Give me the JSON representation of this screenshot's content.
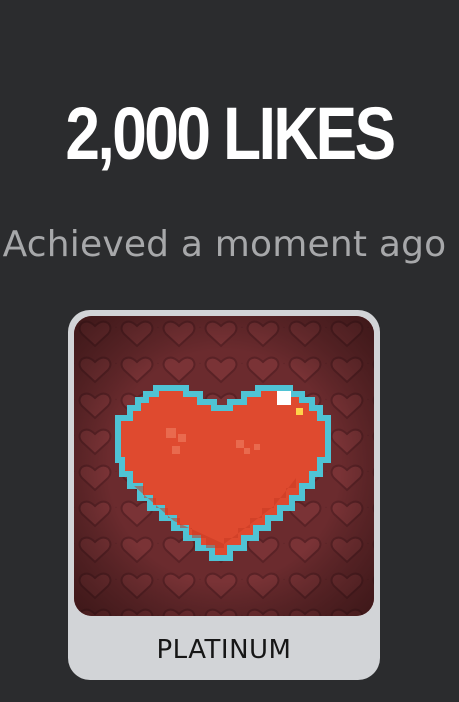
{
  "achievement": {
    "title": "2,000 LIKES",
    "subtitle": "Achieved a moment ago",
    "tier_label": "PLATINUM",
    "icon": "pixel-heart-icon"
  },
  "colors": {
    "background": "#2b2c2e",
    "title": "#ffffff",
    "subtitle": "#a7a8aa",
    "card": "#d2d4d7",
    "heart": "#df4a2f",
    "heart_outline": "#4fc3d4",
    "art_background": "#6a2a2c"
  }
}
